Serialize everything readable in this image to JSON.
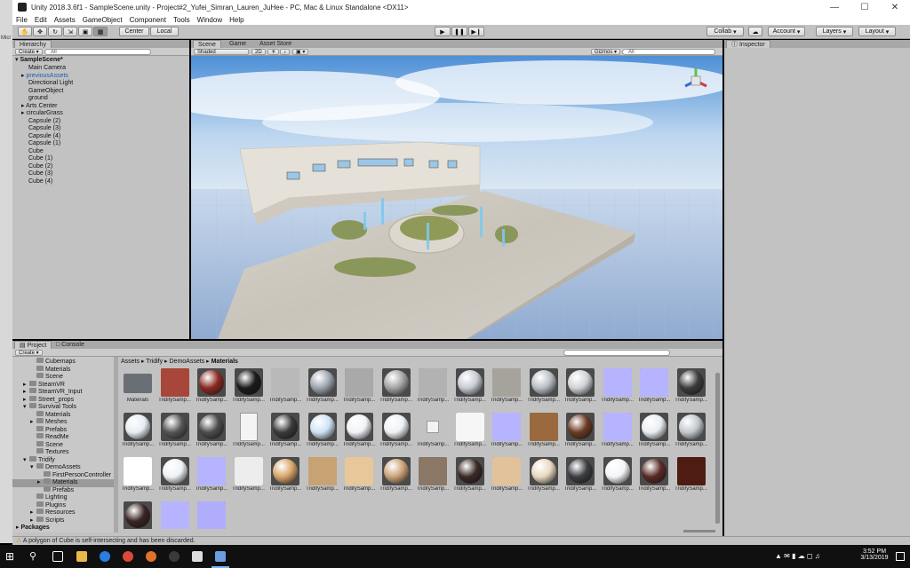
{
  "window": {
    "title": "Unity 2018.3.6f1 - SampleScene.unity - Project#2_Yufei_Simran_Lauren_JuHee - PC, Mac & Linux Standalone <DX11>"
  },
  "menu": [
    "File",
    "Edit",
    "Assets",
    "GameObject",
    "Component",
    "Tools",
    "Window",
    "Help"
  ],
  "toolbar": {
    "center_label": "Center",
    "local_label": "Local",
    "collab_label": "Collab",
    "account_label": "Account",
    "layers_label": "Layers",
    "layout_label": "Layout"
  },
  "hierarchy": {
    "tab": "Hierarchy",
    "create_label": "Create",
    "search_placeholder": "All",
    "scene_name": "SampleScene*",
    "items": [
      {
        "label": "Main Camera",
        "indent": 1,
        "blue": false,
        "arrow": false
      },
      {
        "label": "previousAssets",
        "indent": 1,
        "blue": true,
        "arrow": true
      },
      {
        "label": "Directional Light",
        "indent": 1,
        "blue": false,
        "arrow": false
      },
      {
        "label": "GameObject",
        "indent": 1,
        "blue": false,
        "arrow": false
      },
      {
        "label": "ground",
        "indent": 1,
        "blue": false,
        "arrow": false
      },
      {
        "label": "Arts Center",
        "indent": 1,
        "blue": false,
        "arrow": true
      },
      {
        "label": "circularGrass",
        "indent": 1,
        "blue": false,
        "arrow": true
      },
      {
        "label": "Capsule (2)",
        "indent": 1,
        "blue": false,
        "arrow": false
      },
      {
        "label": "Capsule (3)",
        "indent": 1,
        "blue": false,
        "arrow": false
      },
      {
        "label": "Capsule (4)",
        "indent": 1,
        "blue": false,
        "arrow": false
      },
      {
        "label": "Capsule (1)",
        "indent": 1,
        "blue": false,
        "arrow": false
      },
      {
        "label": "Cube",
        "indent": 1,
        "blue": false,
        "arrow": false
      },
      {
        "label": "Cube (1)",
        "indent": 1,
        "blue": false,
        "arrow": false
      },
      {
        "label": "Cube (2)",
        "indent": 1,
        "blue": false,
        "arrow": false
      },
      {
        "label": "Cube (3)",
        "indent": 1,
        "blue": false,
        "arrow": false
      },
      {
        "label": "Cube (4)",
        "indent": 1,
        "blue": false,
        "arrow": false
      }
    ]
  },
  "scene_view": {
    "tabs": [
      "Scene",
      "Game",
      "Asset Store"
    ],
    "shading": "Shaded",
    "mode_2d": "2D",
    "gizmos_label": "Gizmos",
    "search_placeholder": "All"
  },
  "inspector": {
    "tab": "Inspector"
  },
  "project": {
    "tabs": [
      "Project",
      "Console"
    ],
    "create_label": "Create",
    "breadcrumb": [
      "Assets",
      "Tridify",
      "DemoAssets",
      "Materials"
    ],
    "folders": [
      {
        "label": "Cubemaps",
        "indent": 2
      },
      {
        "label": "Materials",
        "indent": 2
      },
      {
        "label": "Scene",
        "indent": 2
      },
      {
        "label": "SteamVR",
        "indent": 1,
        "arrow": true
      },
      {
        "label": "SteamVR_Input",
        "indent": 1,
        "arrow": true
      },
      {
        "label": "Street_props",
        "indent": 1,
        "arrow": true
      },
      {
        "label": "Survival Tools",
        "indent": 1,
        "arrow": true,
        "open": true
      },
      {
        "label": "Materials",
        "indent": 2
      },
      {
        "label": "Meshes",
        "indent": 2,
        "arrow": true
      },
      {
        "label": "Prefabs",
        "indent": 2
      },
      {
        "label": "ReadMe",
        "indent": 2
      },
      {
        "label": "Scene",
        "indent": 2
      },
      {
        "label": "Textures",
        "indent": 2
      },
      {
        "label": "Tridify",
        "indent": 1,
        "arrow": true,
        "open": true
      },
      {
        "label": "DemoAssets",
        "indent": 2,
        "arrow": true,
        "open": true
      },
      {
        "label": "FirstPersonController",
        "indent": 3
      },
      {
        "label": "Materials",
        "indent": 3,
        "arrow": true,
        "selected": true
      },
      {
        "label": "Prefabs",
        "indent": 3
      },
      {
        "label": "Lighting",
        "indent": 2
      },
      {
        "label": "Plugins",
        "indent": 2
      },
      {
        "label": "Resources",
        "indent": 2,
        "arrow": true
      },
      {
        "label": "Scripts",
        "indent": 2,
        "arrow": true
      }
    ],
    "packages_label": "Packages",
    "assets": [
      {
        "label": "Materials",
        "kind": "folder",
        "color": "#6a6f75"
      },
      {
        "label": "TridifySamp...",
        "kind": "square",
        "color": "#a8463a"
      },
      {
        "label": "TridifySamp...",
        "kind": "sphere",
        "color": "#8a2a22"
      },
      {
        "label": "TridifySamp...",
        "kind": "sphere",
        "color": "#1a1a1a"
      },
      {
        "label": "TridifySamp...",
        "kind": "square",
        "color": "#b9b9b9"
      },
      {
        "label": "TridifySamp...",
        "kind": "sphere",
        "color": "#9da4ad"
      },
      {
        "label": "TridifySamp...",
        "kind": "square",
        "color": "#a9a9a9"
      },
      {
        "label": "TridifySamp...",
        "kind": "sphere",
        "color": "#a3a3a3"
      },
      {
        "label": "TridifySamp...",
        "kind": "square",
        "color": "#b2b2b2"
      },
      {
        "label": "TridifySamp...",
        "kind": "sphere",
        "color": "#c7ccd3"
      },
      {
        "label": "TridifySamp...",
        "kind": "square",
        "color": "#a6a39d"
      },
      {
        "label": "TridifySamp...",
        "kind": "sphere",
        "color": "#b9bec4"
      },
      {
        "label": "TridifySamp...",
        "kind": "sphere",
        "color": "#d0d3d6"
      },
      {
        "label": "TridifySamp...",
        "kind": "square",
        "color": "#b7b4ff"
      },
      {
        "label": "TridifySamp...",
        "kind": "square",
        "color": "#b7b4ff"
      },
      {
        "label": "TridifySamp...",
        "kind": "sphere",
        "color": "#3c3c3c"
      },
      {
        "label": "TridifySamp...",
        "kind": "sphere",
        "color": "#e8eef5"
      },
      {
        "label": "TridifySamp...",
        "kind": "sphere",
        "color": "#555555"
      },
      {
        "label": "TridifySamp...",
        "kind": "sphere",
        "color": "#4c4c4c"
      },
      {
        "label": "TridifySamp...",
        "kind": "doc",
        "color": "#f4f4f4"
      },
      {
        "label": "TridifySamp...",
        "kind": "sphere",
        "color": "#3a3a3a"
      },
      {
        "label": "TridifySamp...",
        "kind": "sphere",
        "color": "#cfe3f5"
      },
      {
        "label": "TridifySamp...",
        "kind": "sphere",
        "color": "#f0f3f7"
      },
      {
        "label": "TridifySamp...",
        "kind": "sphere",
        "color": "#eef1f4"
      },
      {
        "label": "TridifySamp...",
        "kind": "small",
        "color": "#f2f2f2"
      },
      {
        "label": "TridifySamp...",
        "kind": "square",
        "color": "#f6f6f6"
      },
      {
        "label": "TridifySamp...",
        "kind": "square",
        "color": "#b7b4ff"
      },
      {
        "label": "TridifySamp...",
        "kind": "square",
        "color": "#9a6a3e"
      },
      {
        "label": "TridifySamp...",
        "kind": "sphere",
        "color": "#6a3a22"
      },
      {
        "label": "TridifySamp...",
        "kind": "square",
        "color": "#b7b4ff"
      },
      {
        "label": "TridifySamp...",
        "kind": "sphere",
        "color": "#e9eef3"
      },
      {
        "label": "TridifySamp...",
        "kind": "sphere",
        "color": "#c3c8cd"
      },
      {
        "label": "TridifySamp...",
        "kind": "square",
        "color": "#ffffff"
      },
      {
        "label": "TridifySamp...",
        "kind": "sphere",
        "color": "#eef2f6"
      },
      {
        "label": "TridifySamp...",
        "kind": "square",
        "color": "#b7b4ff"
      },
      {
        "label": "TridifySamp...",
        "kind": "square",
        "color": "#ededed"
      },
      {
        "label": "TridifySamp...",
        "kind": "sphere",
        "color": "#d8a46a"
      },
      {
        "label": "TridifySamp...",
        "kind": "square",
        "color": "#c7a272"
      },
      {
        "label": "TridifySamp...",
        "kind": "square",
        "color": "#e8c79a"
      },
      {
        "label": "TridifySamp...",
        "kind": "sphere",
        "color": "#caa177"
      },
      {
        "label": "TridifySamp...",
        "kind": "square",
        "color": "#8b7766"
      },
      {
        "label": "TridifySamp...",
        "kind": "sphere",
        "color": "#3a2a26"
      },
      {
        "label": "TridifySamp...",
        "kind": "square",
        "color": "#e2c29a"
      },
      {
        "label": "TridifySamp...",
        "kind": "sphere",
        "color": "#e9d8c0"
      },
      {
        "label": "TridifySamp...",
        "kind": "sphere",
        "color": "#3c3e42"
      },
      {
        "label": "TridifySamp...",
        "kind": "sphere",
        "color": "#f3f5f8"
      },
      {
        "label": "TridifySamp...",
        "kind": "sphere",
        "color": "#5a2a26"
      },
      {
        "label": "TridifySamp...",
        "kind": "square",
        "color": "#4e1c12"
      },
      {
        "label": "",
        "kind": "sphere",
        "color": "#3a2624"
      },
      {
        "label": "",
        "kind": "square",
        "color": "#b7b4ff"
      },
      {
        "label": "",
        "kind": "square",
        "color": "#b0aefc"
      }
    ]
  },
  "status": {
    "message": "A polygon of Cube is self-intersecting and has been discarded."
  },
  "taskbar": {
    "time": "3:52 PM",
    "date": "3/13/2019"
  }
}
